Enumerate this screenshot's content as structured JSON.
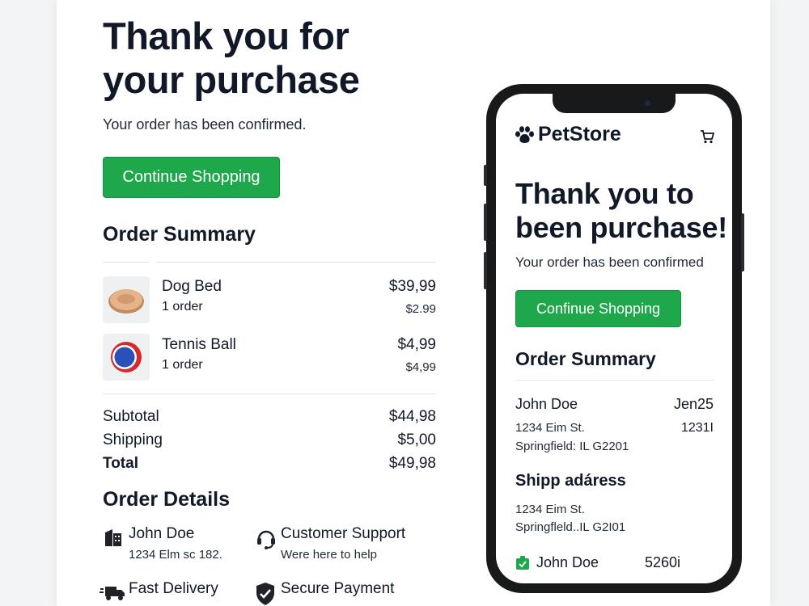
{
  "confirmation": {
    "title_line1": "Thank you for",
    "title_line2": "your purchase",
    "subtitle": "Your order has been confirmed.",
    "continue_button": "Continue Shopping"
  },
  "order_summary": {
    "heading": "Order Summary",
    "items": [
      {
        "name": "Dog Bed",
        "qty": "1 order",
        "price": "$39,99",
        "sub_price": "$2.99",
        "icon": "dog-bed-image"
      },
      {
        "name": "Tennis Ball",
        "qty": "1 order",
        "price": "$4,99",
        "sub_price": "$4,99",
        "icon": "tennis-ball-image"
      }
    ],
    "subtotal_label": "Subtotal",
    "subtotal_value": "$44,98",
    "shipping_label": "Shipping",
    "shipping_value": "$5,00",
    "total_label": "Total",
    "total_value": "$49,98"
  },
  "order_details": {
    "heading": "Order Details",
    "features": [
      {
        "title": "John Doe",
        "text": "1234 Elm sc 182.",
        "icon": "building-icon"
      },
      {
        "title": "Customer Support",
        "text": "Were here to help",
        "icon": "headset-icon"
      },
      {
        "title": "Fast Delivery",
        "text": "",
        "icon": "truck-icon"
      },
      {
        "title": "Secure Payment",
        "text": "",
        "icon": "shield-check-icon"
      }
    ]
  },
  "phone": {
    "brand": "PetStore",
    "brand_icon": "paw-icon",
    "cart_icon": "cart-icon",
    "title_line1": "Thank you to",
    "title_line2": "been purchase!",
    "subtitle": "Your order has been confirmed",
    "continue_button": "Confinue Shopping",
    "summary_heading": "Order Summary",
    "customer_name": "John Doe",
    "order_date": "Jen25",
    "address_line1": "1234 Eim St.",
    "order_number": "1231I",
    "address_line2": "Springfield: IL G2201",
    "ship_heading": "Shipp adáress",
    "ship_line1": "1234 Eim St.",
    "ship_line2": "Springfleld..IL G2I01",
    "footer_name": "John Doe",
    "footer_number": "5260i"
  },
  "colors": {
    "accent_green": "#1fa84b",
    "text_dark": "#111827",
    "phone_frame": "#18191b"
  }
}
